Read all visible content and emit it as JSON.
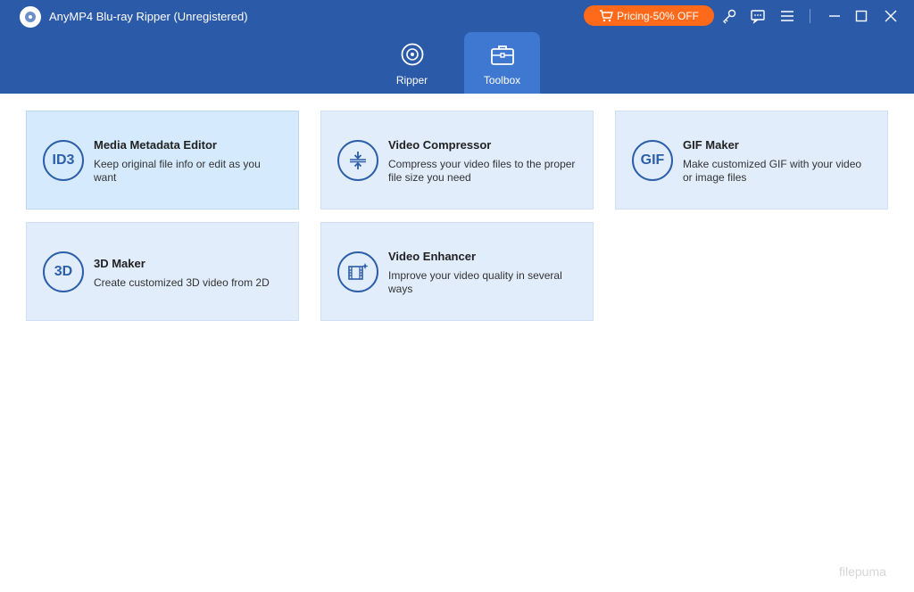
{
  "window": {
    "title": "AnyMP4 Blu-ray Ripper (Unregistered)",
    "pricing_label": "Pricing-50% OFF"
  },
  "header_icons": [
    "key-icon",
    "chat-icon",
    "menu-icon",
    "minimize-icon",
    "maximize-icon",
    "close-icon"
  ],
  "tabs": [
    {
      "label": "Ripper",
      "active": false
    },
    {
      "label": "Toolbox",
      "active": true
    }
  ],
  "tools": [
    {
      "icon_text": "ID3",
      "title": "Media Metadata Editor",
      "description": "Keep original file info or edit as you want"
    },
    {
      "icon_text": "",
      "title": "Video Compressor",
      "description": "Compress your video files to the proper file size you need"
    },
    {
      "icon_text": "GIF",
      "title": "GIF Maker",
      "description": "Make customized GIF with your video or image files"
    },
    {
      "icon_text": "3D",
      "title": "3D Maker",
      "description": "Create customized 3D video from 2D"
    },
    {
      "icon_text": "",
      "title": "Video Enhancer",
      "description": "Improve your video quality in several ways"
    }
  ],
  "watermark": "filepuma",
  "colors": {
    "header": "#2b5aa8",
    "active_tab": "#3f78d0",
    "pricing": "#ff6a1a",
    "card": "#e1edfb",
    "icon": "#2d5ea8"
  }
}
